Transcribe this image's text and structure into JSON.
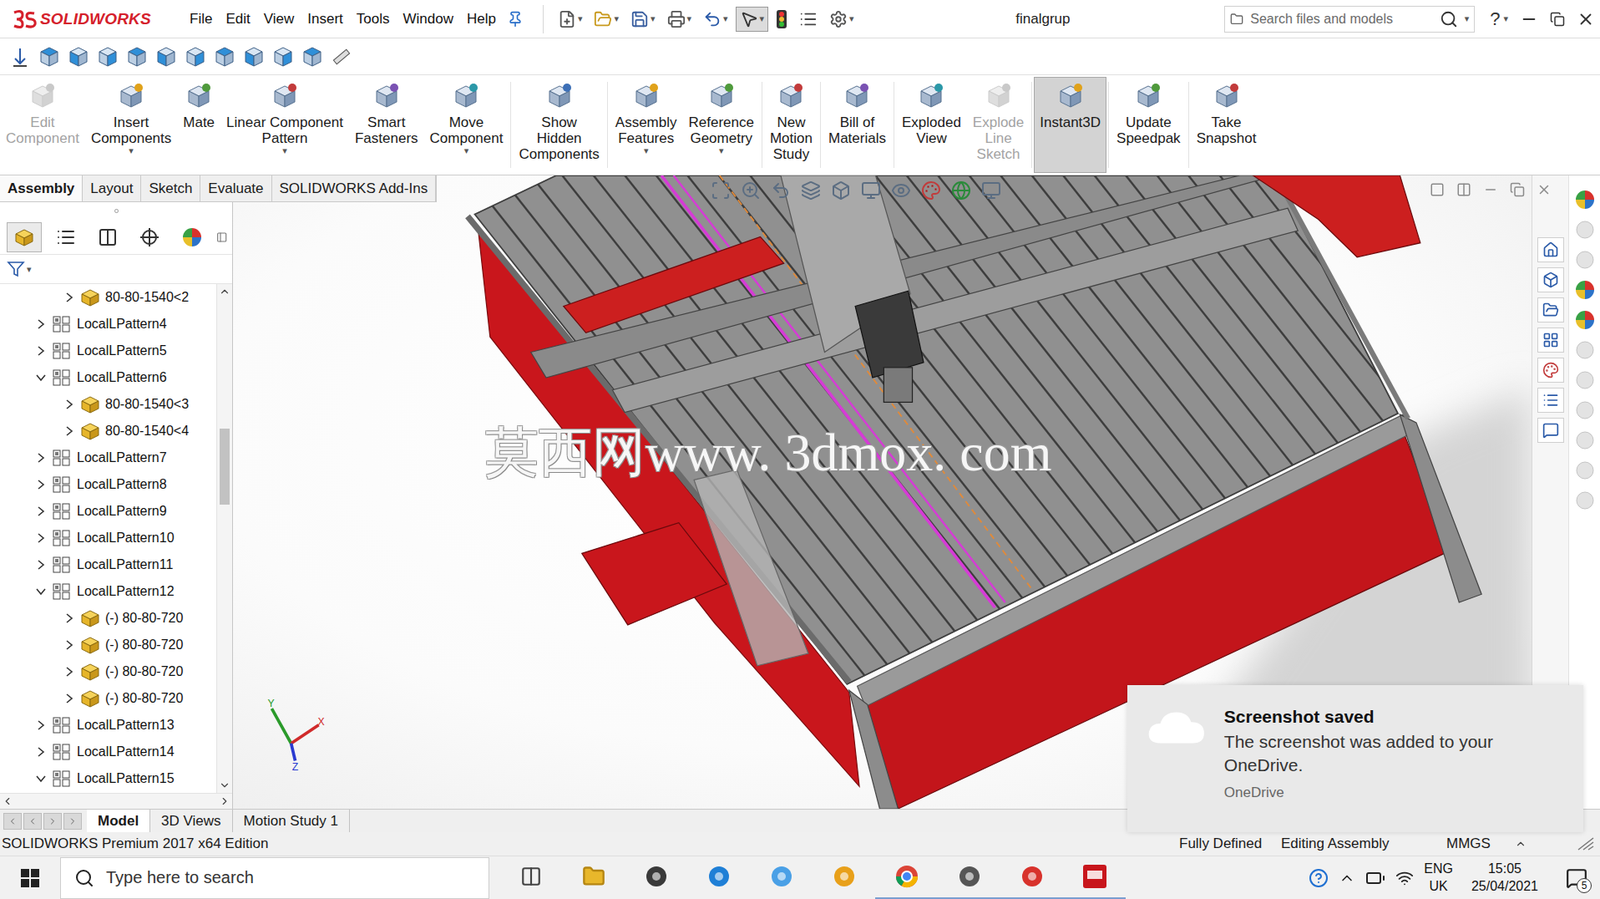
{
  "app": {
    "logo": "SOLIDWORKS",
    "menu": [
      "File",
      "Edit",
      "View",
      "Insert",
      "Tools",
      "Window",
      "Help"
    ],
    "document_title": "finalgrup",
    "search_placeholder": "Search files and models",
    "help": "?",
    "dropdown_mark": "▾"
  },
  "ribbon": [
    {
      "label": "Edit\nComponent",
      "disabled": true,
      "dropdown": false,
      "selected": false
    },
    {
      "label": "Insert\nComponents",
      "disabled": false,
      "dropdown": true,
      "selected": false
    },
    {
      "label": "Mate",
      "disabled": false,
      "dropdown": false,
      "selected": false
    },
    {
      "label": "Linear Component\nPattern",
      "disabled": false,
      "dropdown": true,
      "selected": false
    },
    {
      "label": "Smart\nFasteners",
      "disabled": false,
      "dropdown": false,
      "selected": false
    },
    {
      "label": "Move\nComponent",
      "disabled": false,
      "dropdown": true,
      "selected": false
    },
    {
      "label": "Show\nHidden\nComponents",
      "disabled": false,
      "dropdown": false,
      "selected": false
    },
    {
      "label": "Assembly\nFeatures",
      "disabled": false,
      "dropdown": true,
      "selected": false
    },
    {
      "label": "Reference\nGeometry",
      "disabled": false,
      "dropdown": true,
      "selected": false
    },
    {
      "label": "New\nMotion\nStudy",
      "disabled": false,
      "dropdown": false,
      "selected": false
    },
    {
      "label": "Bill of\nMaterials",
      "disabled": false,
      "dropdown": false,
      "selected": false
    },
    {
      "label": "Exploded\nView",
      "disabled": false,
      "dropdown": false,
      "selected": false
    },
    {
      "label": "Explode\nLine\nSketch",
      "disabled": true,
      "dropdown": false,
      "selected": false
    },
    {
      "label": "Instant3D",
      "disabled": false,
      "dropdown": false,
      "selected": true
    },
    {
      "label": "Update\nSpeedpak",
      "disabled": false,
      "dropdown": false,
      "selected": false
    },
    {
      "label": "Take\nSnapshot",
      "disabled": false,
      "dropdown": false,
      "selected": false
    }
  ],
  "tabs": [
    {
      "label": "Assembly",
      "selected": true
    },
    {
      "label": "Layout",
      "selected": false
    },
    {
      "label": "Sketch",
      "selected": false
    },
    {
      "label": "Evaluate",
      "selected": false
    },
    {
      "label": "SOLIDWORKS Add-Ins",
      "selected": false
    }
  ],
  "tree": {
    "items": [
      {
        "label": "80-80-1540<2",
        "kind": "part",
        "depth": 1,
        "expanded": false
      },
      {
        "label": "LocalLPattern4",
        "kind": "pattern",
        "depth": 0,
        "expanded": false
      },
      {
        "label": "LocalLPattern5",
        "kind": "pattern",
        "depth": 0,
        "expanded": false
      },
      {
        "label": "LocalLPattern6",
        "kind": "pattern",
        "depth": 0,
        "expanded": true
      },
      {
        "label": "80-80-1540<3",
        "kind": "part",
        "depth": 1,
        "expanded": false
      },
      {
        "label": "80-80-1540<4",
        "kind": "part",
        "depth": 1,
        "expanded": false
      },
      {
        "label": "LocalLPattern7",
        "kind": "pattern",
        "depth": 0,
        "expanded": false
      },
      {
        "label": "LocalLPattern8",
        "kind": "pattern",
        "depth": 0,
        "expanded": false
      },
      {
        "label": "LocalLPattern9",
        "kind": "pattern",
        "depth": 0,
        "expanded": false
      },
      {
        "label": "LocalLPattern10",
        "kind": "pattern",
        "depth": 0,
        "expanded": false
      },
      {
        "label": "LocalLPattern11",
        "kind": "pattern",
        "depth": 0,
        "expanded": false
      },
      {
        "label": "LocalLPattern12",
        "kind": "pattern",
        "depth": 0,
        "expanded": true
      },
      {
        "label": "(-) 80-80-720",
        "kind": "part",
        "depth": 1,
        "expanded": false
      },
      {
        "label": "(-) 80-80-720",
        "kind": "part",
        "depth": 1,
        "expanded": false
      },
      {
        "label": "(-) 80-80-720",
        "kind": "part",
        "depth": 1,
        "expanded": false
      },
      {
        "label": "(-) 80-80-720",
        "kind": "part",
        "depth": 1,
        "expanded": false
      },
      {
        "label": "LocalLPattern13",
        "kind": "pattern",
        "depth": 0,
        "expanded": false
      },
      {
        "label": "LocalLPattern14",
        "kind": "pattern",
        "depth": 0,
        "expanded": false
      },
      {
        "label": "LocalLPattern15",
        "kind": "pattern",
        "depth": 0,
        "expanded": true
      }
    ],
    "scrollbar": {
      "offset": 0.27,
      "size": 0.16
    }
  },
  "viewport": {
    "watermark": "莫西网www. 3dmox. com",
    "triad": {
      "x": "X",
      "y": "Y",
      "z": "Z"
    }
  },
  "bottom_tabs": [
    {
      "label": "Model",
      "selected": true
    },
    {
      "label": "3D Views",
      "selected": false
    },
    {
      "label": "Motion Study 1",
      "selected": false
    }
  ],
  "status_bar": {
    "edition": "SOLIDWORKS Premium 2017 x64 Edition",
    "items": [
      "Fully Defined",
      "Editing Assembly",
      "MMGS"
    ]
  },
  "notification": {
    "title": "Screenshot saved",
    "message": "The screenshot was added to your OneDrive.",
    "source": "OneDrive"
  },
  "taskbar": {
    "search_placeholder": "Type here to search",
    "language": "ENG",
    "region": "UK",
    "time": "15:05",
    "date": "25/04/2021",
    "notification_count": "5"
  }
}
